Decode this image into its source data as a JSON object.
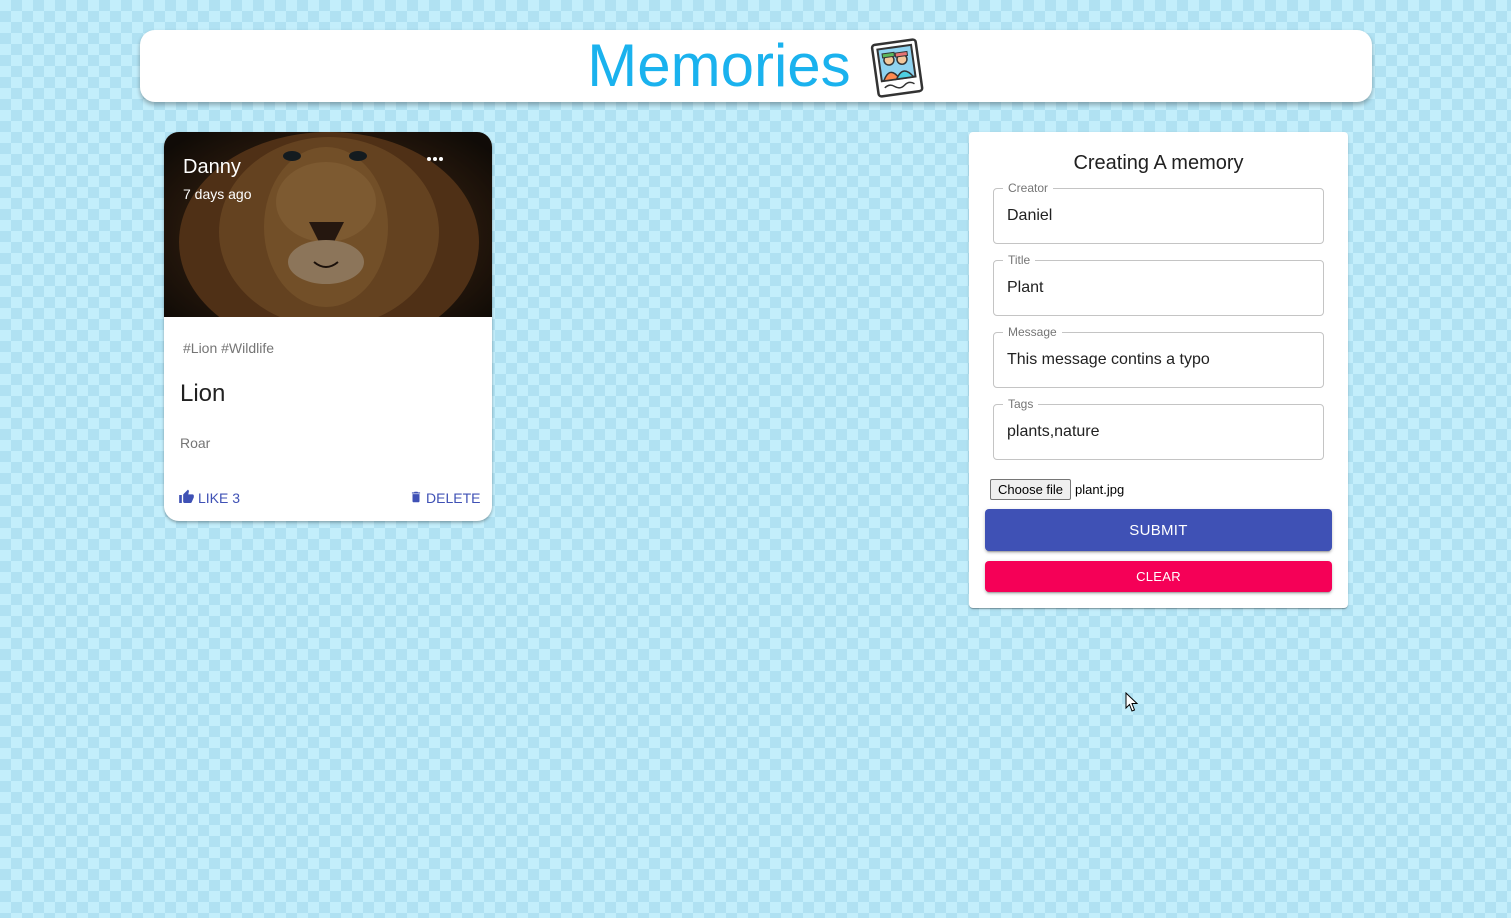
{
  "app": {
    "title": "Memories"
  },
  "post": {
    "creator": "Danny",
    "time": "7 days ago",
    "tags": "#Lion #Wildlife",
    "title": "Lion",
    "message": "Roar",
    "like_label": "LIKE 3",
    "delete_label": "DELETE"
  },
  "form": {
    "heading": "Creating A memory",
    "fields": {
      "creator": {
        "label": "Creator",
        "value": "Daniel"
      },
      "title": {
        "label": "Title",
        "value": "Plant"
      },
      "message": {
        "label": "Message",
        "value": "This message contins a typo"
      },
      "tags": {
        "label": "Tags",
        "value": "plants,nature"
      }
    },
    "file_button": "Choose file",
    "file_name": "plant.jpg",
    "submit_label": "SUBMIT",
    "clear_label": "CLEAR"
  },
  "colors": {
    "primary": "#3f51b5",
    "secondary": "#f50057",
    "title": "#1ab2ee",
    "background": "#c3eefb"
  },
  "icons": [
    "memories-logo-icon",
    "more-horizontal-icon",
    "thumb-up-icon",
    "delete-icon",
    "mouse-cursor-icon"
  ]
}
